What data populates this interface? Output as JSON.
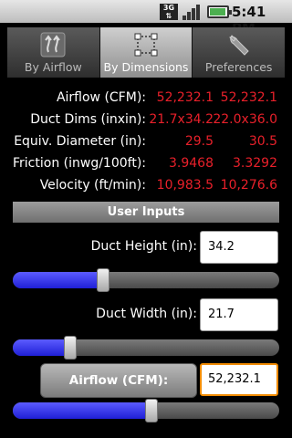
{
  "status_bar": {
    "network_label": "3G",
    "time": "5:41 PM",
    "icons": [
      "3g-icon",
      "signal-icon",
      "battery-icon"
    ]
  },
  "tabs": [
    {
      "label": "By Airflow",
      "icon": "airflow-icon",
      "active": false
    },
    {
      "label": "By Dimensions",
      "icon": "dimensions-icon",
      "active": true
    },
    {
      "label": "Preferences",
      "icon": "wrench-icon",
      "active": false
    }
  ],
  "results": [
    {
      "label": "Airflow (CFM):",
      "value1": "52,232.1",
      "value2": "52,232.1"
    },
    {
      "label": "Duct Dims (inxin):",
      "value1": "21.7x34.2",
      "value2": "22.0x36.0"
    },
    {
      "label": "Equiv. Diameter (in):",
      "value1": "29.5",
      "value2": "30.5"
    },
    {
      "label": "Friction (inwg/100ft):",
      "value1": "3.9468",
      "value2": "3.3292"
    },
    {
      "label": "Velocity (ft/min):",
      "value1": "10,983.5",
      "value2": "10,276.6"
    }
  ],
  "user_inputs": {
    "header": "User Inputs",
    "duct_height": {
      "label": "Duct Height (in):",
      "value": "34.2",
      "slider_fraction": 0.34
    },
    "duct_width": {
      "label": "Duct Width (in):",
      "value": "21.7",
      "slider_fraction": 0.215
    },
    "airflow": {
      "button_label": "Airflow (CFM):",
      "value": "52,232.1",
      "slider_fraction": 0.52
    }
  },
  "colors": {
    "result_value": "#e8202a",
    "slider_progress": "#3030e8",
    "focus_border": "#f08a00"
  }
}
